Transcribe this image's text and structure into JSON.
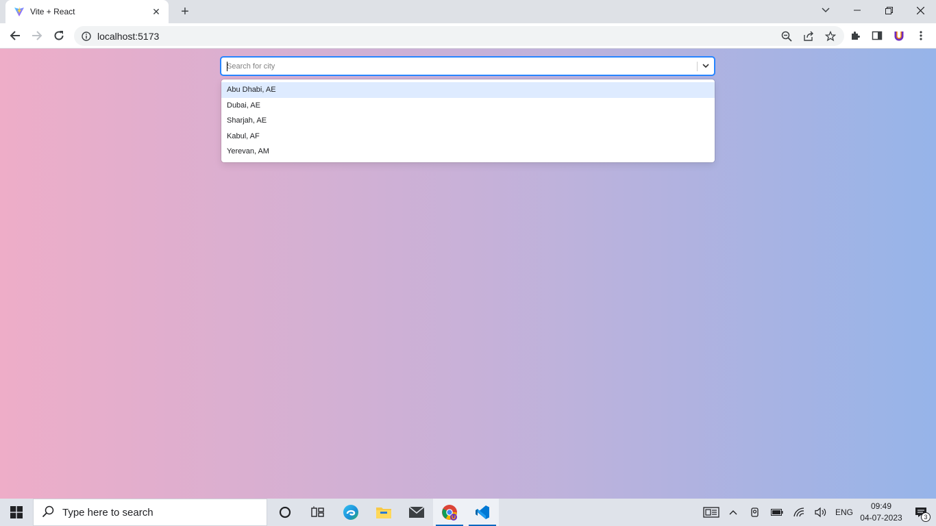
{
  "browser": {
    "tab_title": "Vite + React",
    "tab_close_glyph": "✕",
    "new_tab_glyph": "+",
    "url": "localhost:5173"
  },
  "search": {
    "placeholder": "Search for city",
    "options": [
      "Abu Dhabi, AE",
      "Dubai, AE",
      "Sharjah, AE",
      "Kabul, AF",
      "Yerevan, AM"
    ]
  },
  "taskbar": {
    "search_placeholder": "Type here to search",
    "language": "ENG",
    "time": "09:49",
    "date": "04-07-2023",
    "notification_count": "3"
  },
  "colors": {
    "gradient_left": "#eeadc8",
    "gradient_right": "#96b4e9",
    "focus_border": "#2684ff",
    "option_focus": "#deebff"
  },
  "icons": {
    "favicon": "vite-logo-icon",
    "back": "back-arrow-icon",
    "forward": "forward-arrow-icon",
    "reload": "reload-icon",
    "site_info": "info-icon",
    "zoom": "zoom-out-icon",
    "share": "share-icon",
    "bookmark": "star-icon",
    "extensions": "puzzle-icon",
    "side_panel": "side-panel-icon",
    "profile_extension": "u-extension-icon",
    "menu": "kebab-menu-icon"
  }
}
